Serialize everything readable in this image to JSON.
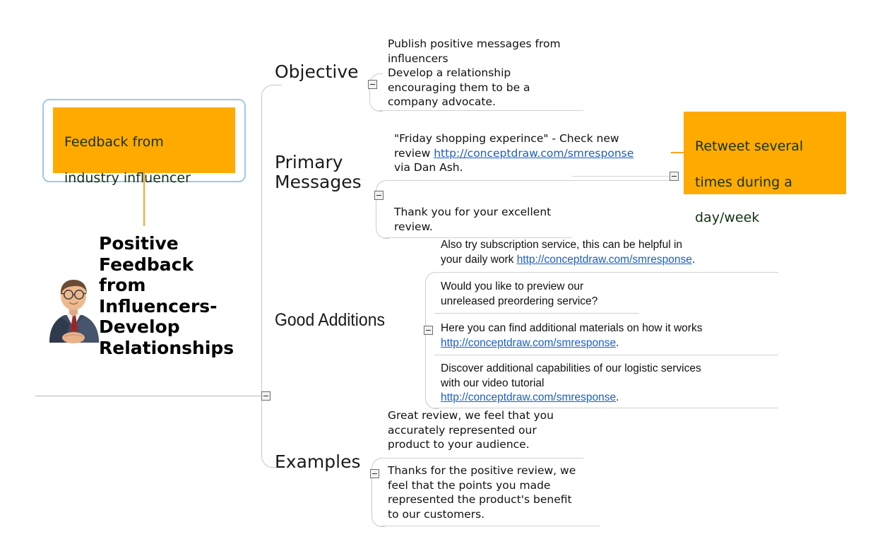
{
  "central": {
    "title": "Positive Feedback from Influencers-Develop Relationships",
    "avatar_alt": "businessman-avatar"
  },
  "callouts": [
    {
      "id": "feedback-from-influencer",
      "text": "Feedback from industry influencer",
      "fill": "#FFAA00",
      "border": "#9fc8ee"
    },
    {
      "id": "retweet-note",
      "text": "Retweet  several times during a day/week",
      "fill": "#FFAA00",
      "border": "none"
    }
  ],
  "branches": [
    {
      "label": "Objective",
      "leaves": [
        {
          "text": "Publish positive messages from influencers Develop a relationship encouraging them to be a company advocate."
        }
      ]
    },
    {
      "label": "Primary Messages",
      "leaves": [
        {
          "text": "\"Friday shopping experince\" - Check new review  http://conceptdraw.com/smresponse via Dan Ash.",
          "link": "http://conceptdraw.com/smresponse"
        },
        {
          "text": "Thank you for your excellent review."
        }
      ]
    },
    {
      "label": "Good Additions",
      "leaves": [
        {
          "text": "Also try subscription service, this can be helpful in your daily work http://conceptdraw.com/smresponse.",
          "link": "http://conceptdraw.com/smresponse"
        },
        {
          "text": "Would you like to preview our unreleased preordering service?"
        },
        {
          "text": "Here you can find additional materials on how it works http://conceptdraw.com/smresponse.",
          "link": "http://conceptdraw.com/smresponse"
        },
        {
          "text": "Discover additional capabilities of our logistic services with our video tutorial http://conceptdraw.com/smresponse.",
          "link": "http://conceptdraw.com/smresponse"
        }
      ]
    },
    {
      "label": "Examples",
      "leaves": [
        {
          "text": "Great review, we feel that you accurately represented our product to your audience."
        },
        {
          "text": "Thanks for the positive review, we feel that the points you made represented the product's benefit to our customers."
        }
      ]
    }
  ],
  "text_fragments": {
    "objective_1": "Publish positive messages from",
    "objective_2": "influencers",
    "objective_3": "Develop a relationship",
    "objective_4": "encouraging them to be a",
    "objective_5": "company advocate.",
    "pm1_1": "\"Friday shopping experince\" - Check new",
    "pm1_2a": "review  ",
    "pm1_2b": "http://conceptdraw.com/smresponse",
    "pm1_3": "via Dan Ash.",
    "pm2_1": "Thank you for your excellent",
    "pm2_2": "review.",
    "ga1_1": "Also try subscription service, this can be helpful in",
    "ga1_2a": "your daily work ",
    "ga1_2b": "http://conceptdraw.com/smresponse",
    "ga1_2c": ".",
    "ga2_1": "Would you like to preview our",
    "ga2_2": "unreleased preordering service?",
    "ga3_1": "Here you can find additional materials on how it works",
    "ga3_2a": "http://conceptdraw.com/smresponse",
    "ga3_2b": ".",
    "ga4_1": "Discover additional capabilities of our logistic services",
    "ga4_2": "with our video tutorial",
    "ga4_3a": "http://conceptdraw.com/smresponse",
    "ga4_3b": ".",
    "ex1_1": "Great review, we feel that you",
    "ex1_2": "accurately represented our",
    "ex1_3": "product to your audience.",
    "ex2_1": "Thanks for the positive review, we",
    "ex2_2": "feel that the points you made",
    "ex2_3": "represented the product's benefit",
    "ex2_4": "to our customers.",
    "branch_objective": "Objective",
    "branch_primary": "Primary\nMessages",
    "branch_good": "Good Additions",
    "branch_examples": "Examples",
    "central_l1": "Positive",
    "central_l2": "Feedback",
    "central_l3": "from",
    "central_l4": "Influencers-",
    "central_l5": "Develop",
    "central_l6": "Relationships",
    "callout_feedback_l1": "Feedback from",
    "callout_feedback_l2": "industry influencer",
    "callout_retweet_l1": "Retweet  several",
    "callout_retweet_l2": "times during a",
    "callout_retweet_l3": "day/week"
  }
}
